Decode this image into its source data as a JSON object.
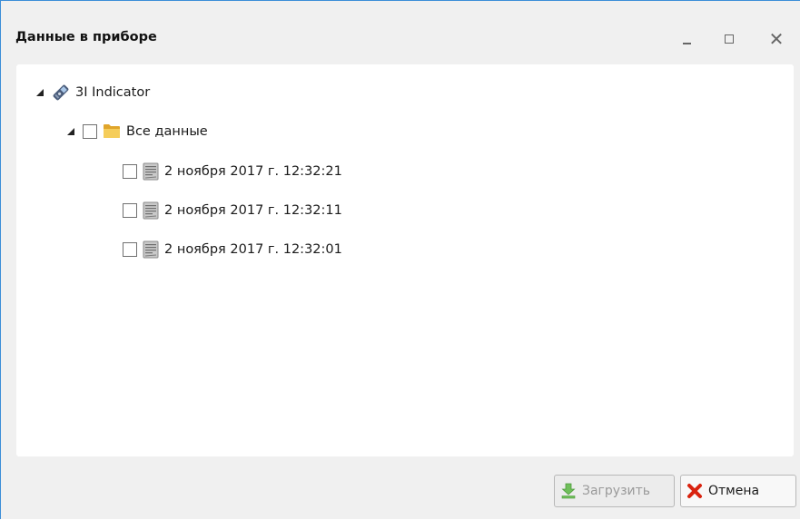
{
  "window": {
    "title": "Данные в приборе",
    "controls": {
      "minimize": "minimize-icon",
      "maximize": "maximize-icon",
      "close": "close-icon"
    }
  },
  "tree": {
    "device": {
      "label": "3I Indicator",
      "icon": "device-icon",
      "expanded": true
    },
    "folder": {
      "label": "Все данные",
      "icon": "folder-icon",
      "expanded": true,
      "checked": false
    },
    "records": [
      {
        "label": "2 ноября 2017 г. 12:32:21",
        "icon": "data-file-icon",
        "checked": false
      },
      {
        "label": "2 ноября 2017 г. 12:32:11",
        "icon": "data-file-icon",
        "checked": false
      },
      {
        "label": "2 ноября 2017 г. 12:32:01",
        "icon": "data-file-icon",
        "checked": false
      }
    ]
  },
  "buttons": {
    "load": {
      "label": "Загрузить",
      "icon": "download-icon",
      "enabled": false
    },
    "cancel": {
      "label": "Отмена",
      "icon": "cancel-x-icon",
      "enabled": true
    }
  },
  "colors": {
    "accent_border": "#3c8ed8",
    "download_green": "#5cb85c",
    "cancel_red": "#d9230f",
    "folder_yellow": "#f2c94c"
  }
}
